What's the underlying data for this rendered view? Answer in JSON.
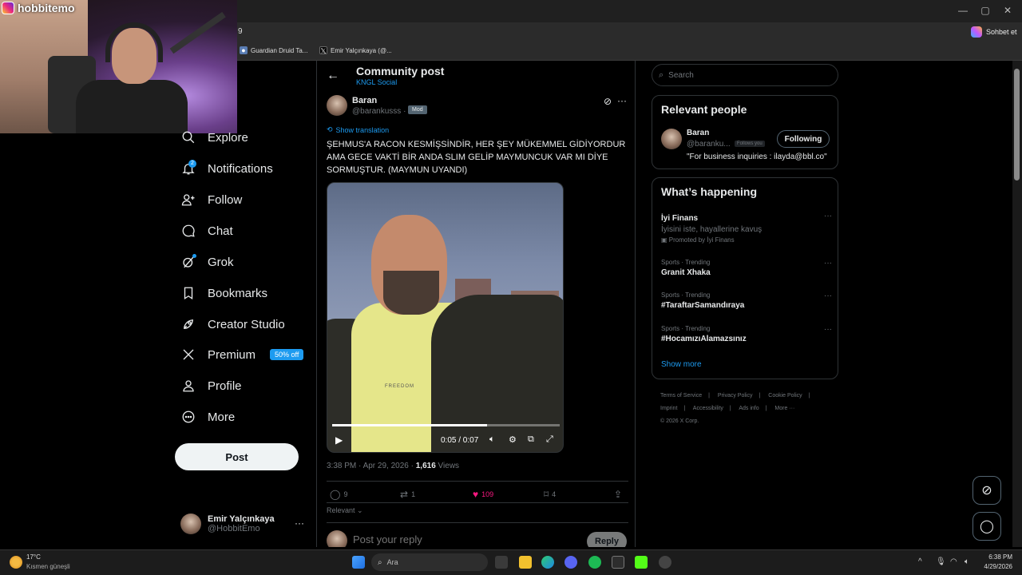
{
  "browser": {
    "bookmarks": [
      {
        "label": "Guardian Druid Ta..."
      },
      {
        "label": "Emir Yalçınkaya (@..."
      }
    ],
    "address_fragment": "9",
    "copilot_label": "Sohbet et"
  },
  "webcam": {
    "username": "hobbitemo"
  },
  "nav": {
    "items": [
      {
        "label": "Explore",
        "icon": "search-icon"
      },
      {
        "label": "Notifications",
        "icon": "bell-icon"
      },
      {
        "label": "Follow",
        "icon": "person-add-icon"
      },
      {
        "label": "Chat",
        "icon": "chat-bubble-icon"
      },
      {
        "label": "Grok",
        "icon": "grok-icon"
      },
      {
        "label": "Bookmarks",
        "icon": "bookmark-icon"
      },
      {
        "label": "Creator Studio",
        "icon": "rocket-icon"
      },
      {
        "label": "Premium",
        "icon": "x-logo-icon"
      },
      {
        "label": "Profile",
        "icon": "person-icon"
      },
      {
        "label": "More",
        "icon": "more-circle-icon"
      }
    ],
    "notification_count": "2",
    "premium_badge": "50% off",
    "post_button": "Post"
  },
  "account": {
    "name": "Emir Yalçınkaya",
    "handle": "@HobbitEmo",
    "more": "···"
  },
  "post": {
    "header_title": "Community post",
    "header_subtitle": "KNGL Social",
    "author_name": "Baran",
    "author_handle": "@barankusss",
    "author_separator": "·",
    "mod_badge": "Mod",
    "show_translation": "Show translation",
    "text": "ŞEHMUS'A RACON KESMİŞSİNDİR, HER ŞEY MÜKEMMEL GİDİYORDUR AMA GECE VAKTİ BİR ANDA SLIM GELİP MAYMUNCUK VAR MI DİYE SORMUŞTUR. (MAYMUN UYANDI)",
    "video": {
      "time": "0:05 / 0:07",
      "progress": 0.68,
      "shirt_text": "FREEDOM"
    },
    "meta_time": "3:38 PM · Apr 29, 2026 · ",
    "meta_views": "1,616",
    "meta_views_label": " Views",
    "stats": {
      "replies": "9",
      "reposts": "1",
      "likes": "109",
      "bookmarks": "4"
    },
    "sort_label": "Relevant",
    "reply_placeholder": "Post your reply",
    "reply_button": "Reply"
  },
  "right": {
    "search_placeholder": "Search",
    "relevant_people": {
      "title": "Relevant people",
      "name": "Baran",
      "handle": "@baranku...",
      "follows_you": "Follows you",
      "follow_button": "Following",
      "bio": "\"For business inquiries : ilayda@bbl.co\""
    },
    "happening": {
      "title": "What’s happening",
      "trends": [
        {
          "category": "",
          "title": "İyi Finans",
          "subtitle": "İyisini iste, hayallerine kavuş",
          "promo": "Promoted by İyi Finans"
        },
        {
          "category": "Sports · Trending",
          "title": "Granit Xhaka"
        },
        {
          "category": "Sports · Trending",
          "title": "#TaraftarSamandıraya"
        },
        {
          "category": "Sports · Trending",
          "title": "#HocamızıAlamazsınız"
        }
      ],
      "show_more": "Show more"
    },
    "footer": [
      [
        "Terms of Service",
        "|",
        "Privacy Policy",
        "|",
        "Cookie Policy",
        "|"
      ],
      [
        "Imprint",
        "|",
        "Accessibility",
        "|",
        "Ads info",
        "|",
        "More ···"
      ],
      [
        "© 2026 X Corp."
      ]
    ]
  },
  "taskbar": {
    "weather_temp": "17°C",
    "weather_desc": "Kısmen güneşli",
    "search_label": "Ara",
    "time": "6:38 PM",
    "date": "4/29/2026"
  },
  "colors": {
    "accent": "#1d9bf0",
    "like": "#f91880",
    "background": "#000000"
  }
}
